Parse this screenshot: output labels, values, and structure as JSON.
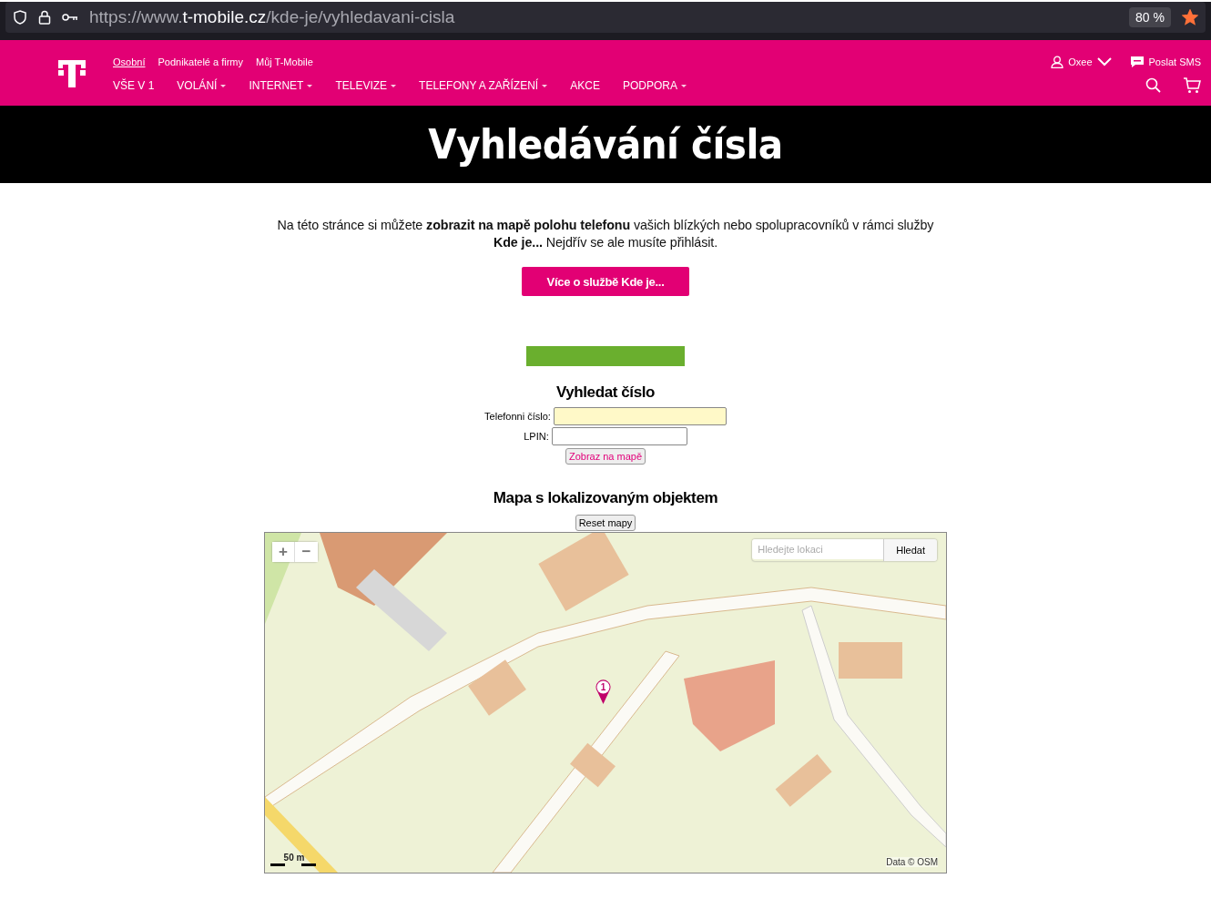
{
  "browser": {
    "url_parts": [
      "https://www.",
      "t-mobile.cz",
      "/kde-je/vyhledavani-cisla"
    ],
    "zoom": "80 %",
    "bookmarked": true
  },
  "header": {
    "segments": [
      {
        "label": "Osobní",
        "selected": true
      },
      {
        "label": "Podnikatelé a firmy",
        "selected": false
      },
      {
        "label": "Můj T-Mobile",
        "selected": false
      }
    ],
    "menu": [
      {
        "label": "VŠE V 1",
        "dropdown": false
      },
      {
        "label": "VOLÁNÍ",
        "dropdown": true
      },
      {
        "label": "INTERNET",
        "dropdown": true
      },
      {
        "label": "TELEVIZE",
        "dropdown": true
      },
      {
        "label": "TELEFONY A ZAŘÍZENÍ",
        "dropdown": true
      },
      {
        "label": "AKCE",
        "dropdown": false
      },
      {
        "label": "PODPORA",
        "dropdown": true
      }
    ],
    "account": "Oxee",
    "sms": "Poslat SMS"
  },
  "hero": {
    "title": "Vyhledávání čísla"
  },
  "intro": {
    "text": "Na této stránce si můžete **zobrazit na mapě polohu telefonu** vašich blízkých nebo spolupracovníků v rámci služby **Kde je...** Nejdřív se ale musíte přihlásit.",
    "button": "Více o službě Kde je..."
  },
  "search": {
    "title": "Vyhledat číslo",
    "fields": [
      {
        "label": "Telefonni číslo:",
        "highlighted": true
      },
      {
        "label": "LPIN:",
        "highlighted": false
      }
    ],
    "submit": "Zobraz na mapě"
  },
  "map": {
    "title": "Mapa s lokalizovaným objektem",
    "reset": "Reset mapy",
    "zoom_in": "+",
    "zoom_out": "−",
    "search_placeholder": "Hledejte lokaci",
    "search_button": "Hledat",
    "scale": "50 m",
    "attribution": "Data © OSM",
    "marker": "1"
  }
}
